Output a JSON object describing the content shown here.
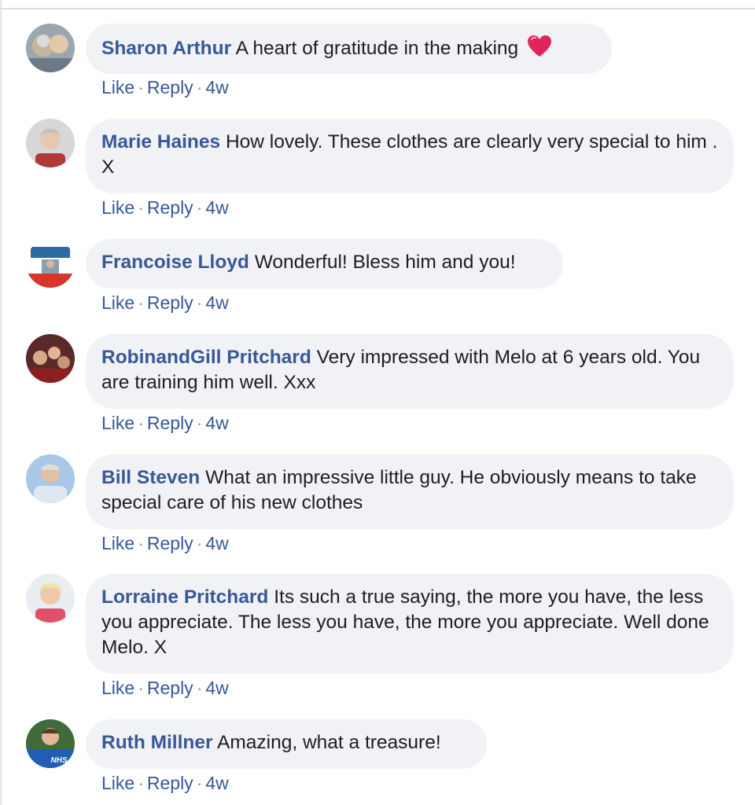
{
  "comments": [
    {
      "author": "Sharon Arthur",
      "text": "A heart of gratitude in the making",
      "emoji": "heart-icon",
      "like": "Like",
      "reply": "Reply",
      "time": "4w"
    },
    {
      "author": "Marie Haines",
      "text": "How lovely. These clothes are clearly very special to him . X",
      "like": "Like",
      "reply": "Reply",
      "time": "4w"
    },
    {
      "author": "Francoise Lloyd",
      "text": "Wonderful! Bless him and you!",
      "like": "Like",
      "reply": "Reply",
      "time": "4w"
    },
    {
      "author": "RobinandGill Pritchard",
      "text": "Very impressed with Melo at 6 years old. You are training him well. Xxx",
      "like": "Like",
      "reply": "Reply",
      "time": "4w"
    },
    {
      "author": "Bill Steven",
      "text": "What an impressive little guy. He obviously means to take special care of his new clothes",
      "like": "Like",
      "reply": "Reply",
      "time": "4w"
    },
    {
      "author": "Lorraine Pritchard",
      "text": "Its such a true saying, the more you have, the less you appreciate. The less you have, the more you appreciate. Well done Melo. X",
      "like": "Like",
      "reply": "Reply",
      "time": "4w"
    },
    {
      "author": "Ruth Millner",
      "text": "Amazing, what a treasure!",
      "avatar_badge": "NHS",
      "like": "Like",
      "reply": "Reply",
      "time": "4w"
    }
  ],
  "colors": {
    "name": "#385898",
    "bubble": "#f0f2f5",
    "text": "#1c1e21",
    "heart": "#e0245e"
  }
}
